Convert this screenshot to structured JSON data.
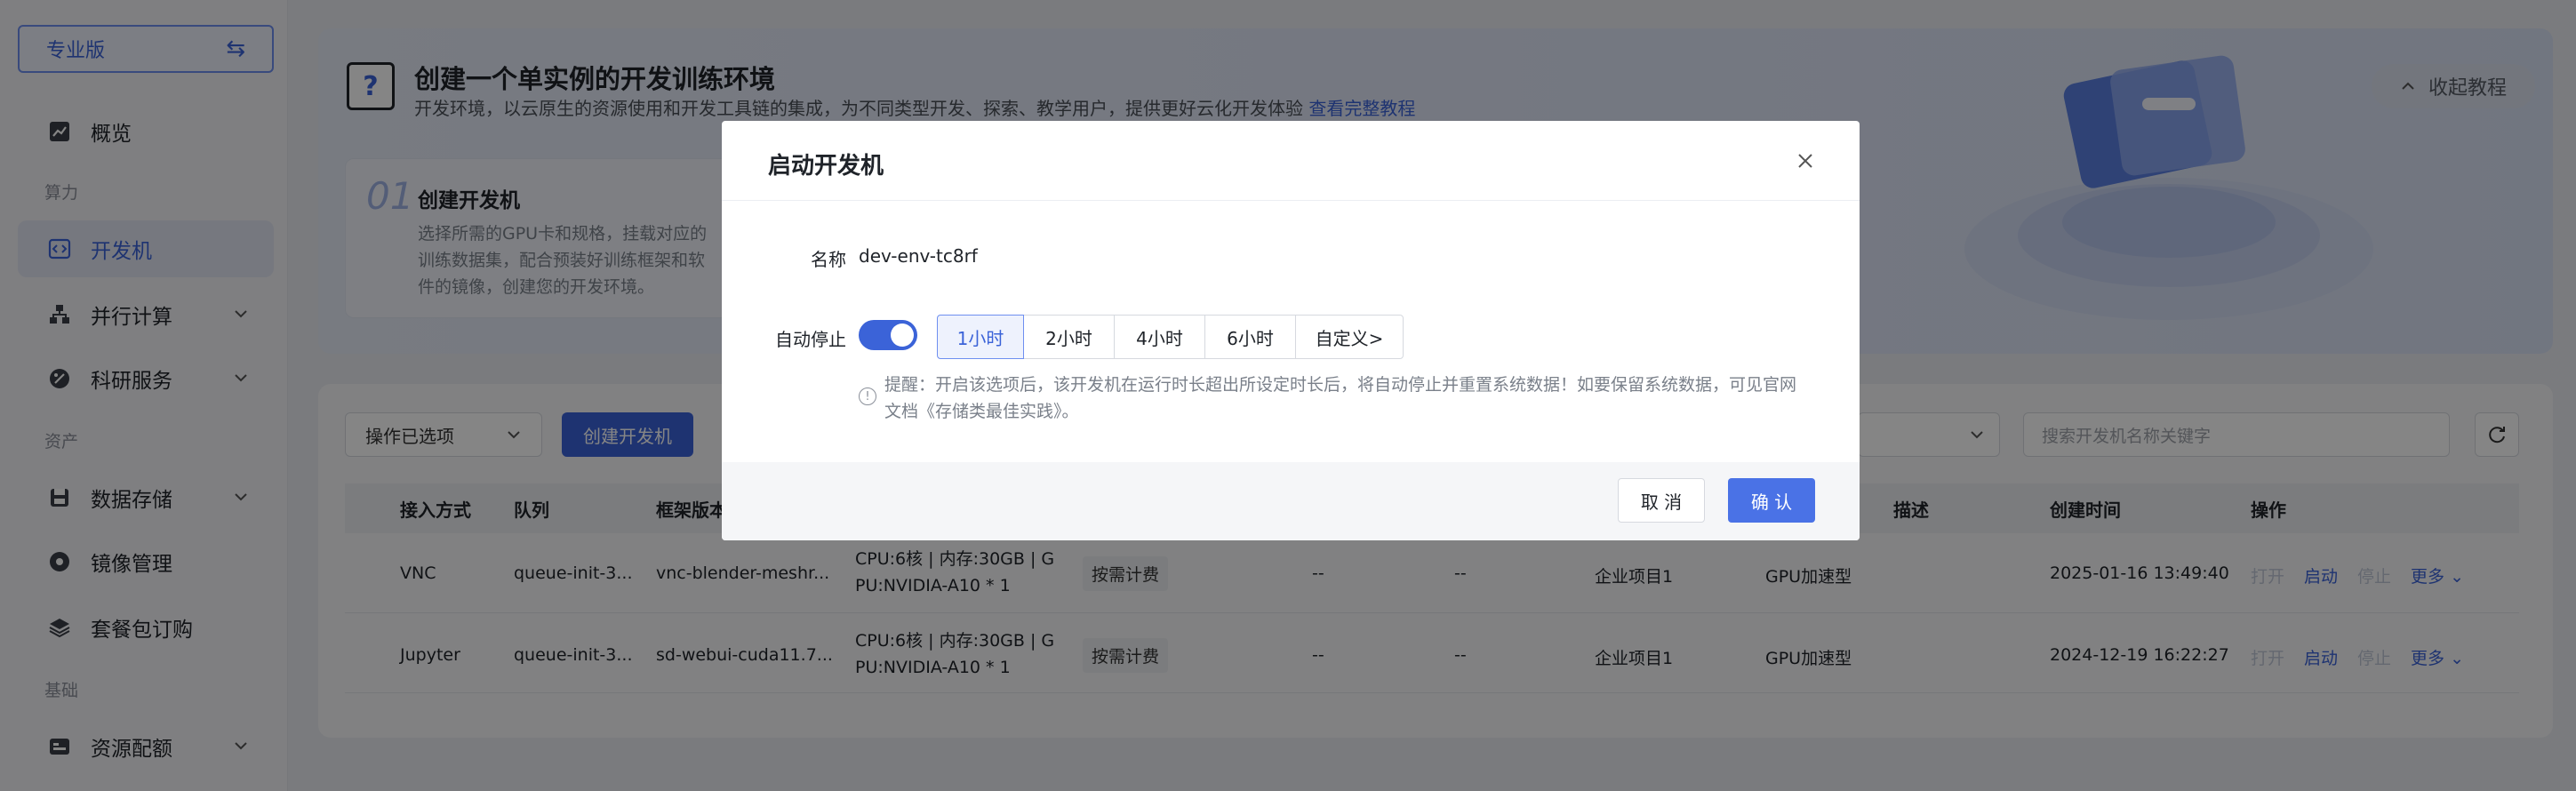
{
  "sidebar": {
    "edition": "专业版",
    "sections": {
      "compute": "算力",
      "assets": "资产",
      "basic": "基础"
    },
    "items": [
      {
        "label": "概览",
        "icon": "chart-icon"
      },
      {
        "label": "开发机",
        "icon": "code-icon",
        "active": true
      },
      {
        "label": "并行计算",
        "icon": "cluster-icon"
      },
      {
        "label": "科研服务",
        "icon": "research-icon"
      },
      {
        "label": "数据存储",
        "icon": "storage-icon"
      },
      {
        "label": "镜像管理",
        "icon": "disc-icon"
      },
      {
        "label": "套餐包订购",
        "icon": "layers-icon"
      },
      {
        "label": "资源配额",
        "icon": "quota-icon"
      }
    ]
  },
  "banner": {
    "title": "创建一个单实例的开发训练环境",
    "subtitle": "开发环境，以云原生的资源使用和开发工具链的集成，为不同类型开发、探索、教学用户，提供更好云化开发体验",
    "link": "查看完整教程",
    "collapse": "收起教程",
    "step": {
      "num": "01",
      "title": "创建开发机",
      "desc": "选择所需的GPU卡和规格，挂载对应的训练数据集，配合预装好训练框架和软件的镜像，创建您的开发环境。"
    }
  },
  "toolbar": {
    "bulk_action": "操作已选项",
    "create": "创建开发机",
    "search_placeholder": "搜索开发机名称关键字"
  },
  "table": {
    "headers": {
      "access": "接入方式",
      "queue": "队列",
      "framework": "框架版本",
      "desc": "描述",
      "created": "创建时间",
      "ops": "操作"
    },
    "rows": [
      {
        "access": "VNC",
        "queue": "queue-init-3...",
        "framework": "vnc-blender-meshr...",
        "spec1": "CPU:6核 | 内存:30GB | G",
        "spec2": "PU:NVIDIA-A10 * 1",
        "billing": "按需计费",
        "c1": "--",
        "c2": "--",
        "project": "企业项目1",
        "type": "GPU加速型",
        "created": "2025-01-16 13:49:40",
        "op_open": "打开",
        "op_start": "启动",
        "op_stop": "停止",
        "op_more": "更多"
      },
      {
        "access": "Jupyter",
        "queue": "queue-init-3...",
        "framework": "sd-webui-cuda11.7...",
        "spec1": "CPU:6核 | 内存:30GB | G",
        "spec2": "PU:NVIDIA-A10 * 1",
        "billing": "按需计费",
        "c1": "--",
        "c2": "--",
        "project": "企业项目1",
        "type": "GPU加速型",
        "created": "2024-12-19 16:22:27",
        "op_open": "打开",
        "op_start": "启动",
        "op_stop": "停止",
        "op_more": "更多"
      }
    ]
  },
  "modal": {
    "title": "启动开发机",
    "name_label": "名称",
    "name_value": "dev-env-tc8rf",
    "autostop_label": "自动停止",
    "autostop_enabled": true,
    "durations": [
      "1小时",
      "2小时",
      "4小时",
      "6小时",
      "自定义>"
    ],
    "selected_duration": "1小时",
    "hint_line1": "提醒：开启该选项后，该开发机在运行时长超出所设定时长后，将自动停止并重置系统数据！如要保留系统数据，可见官网",
    "hint_line2": "文档《存储类最佳实践》。",
    "cancel": "取 消",
    "confirm": "确 认"
  },
  "colors": {
    "accent": "#3b63d8",
    "mask": "rgba(0,0,0,0.48)"
  }
}
